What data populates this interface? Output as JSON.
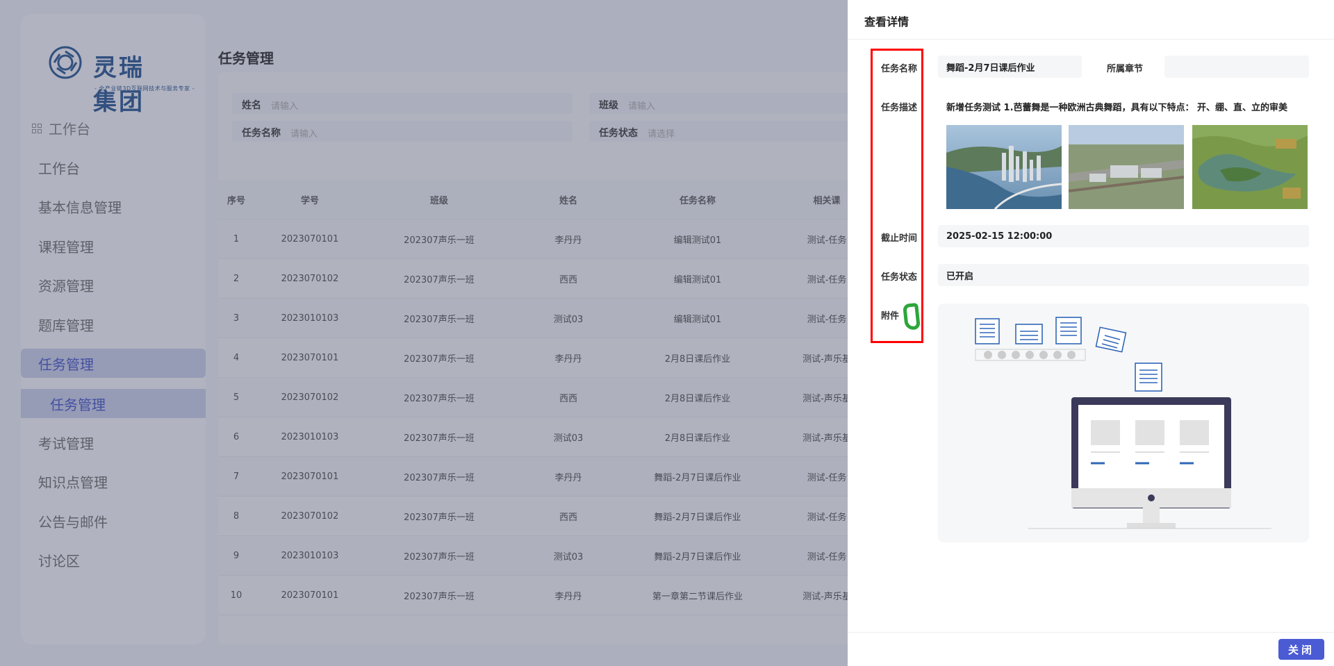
{
  "brand": {
    "name": "灵瑞集团",
    "tagline": "- 全产业链3D互联网技术与服务专家 -",
    "color": "#1d4d8c"
  },
  "sidebar": {
    "group_label": "工作台",
    "items": [
      {
        "label": "工作台"
      },
      {
        "label": "基本信息管理"
      },
      {
        "label": "课程管理"
      },
      {
        "label": "资源管理"
      },
      {
        "label": "题库管理"
      },
      {
        "label": "任务管理",
        "active": true
      },
      {
        "label": "任务管理",
        "sub": true
      },
      {
        "label": "考试管理"
      },
      {
        "label": "知识点管理"
      },
      {
        "label": "公告与邮件"
      },
      {
        "label": "讨论区"
      }
    ]
  },
  "page": {
    "title": "任务管理",
    "filters": {
      "name_label": "姓名",
      "name_placeholder": "请输入",
      "class_label": "班级",
      "class_placeholder": "请输入",
      "task_label": "任务名称",
      "task_placeholder": "请输入",
      "status_label": "任务状态",
      "status_placeholder": "请选择"
    },
    "table": {
      "columns": [
        "序号",
        "学号",
        "班级",
        "姓名",
        "任务名称",
        "相关课"
      ],
      "rows": [
        [
          "1",
          "2023070101",
          "202307声乐一班",
          "李丹丹",
          "编辑测试01",
          "测试-任务"
        ],
        [
          "2",
          "2023070102",
          "202307声乐一班",
          "西西",
          "编辑测试01",
          "测试-任务"
        ],
        [
          "3",
          "2023010103",
          "202307声乐一班",
          "测试03",
          "编辑测试01",
          "测试-任务"
        ],
        [
          "4",
          "2023070101",
          "202307声乐一班",
          "李丹丹",
          "2月8日课后作业",
          "测试-声乐基"
        ],
        [
          "5",
          "2023070102",
          "202307声乐一班",
          "西西",
          "2月8日课后作业",
          "测试-声乐基"
        ],
        [
          "6",
          "2023010103",
          "202307声乐一班",
          "测试03",
          "2月8日课后作业",
          "测试-声乐基"
        ],
        [
          "7",
          "2023070101",
          "202307声乐一班",
          "李丹丹",
          "舞蹈-2月7日课后作业",
          "测试-任务"
        ],
        [
          "8",
          "2023070102",
          "202307声乐一班",
          "西西",
          "舞蹈-2月7日课后作业",
          "测试-任务"
        ],
        [
          "9",
          "2023010103",
          "202307声乐一班",
          "测试03",
          "舞蹈-2月7日课后作业",
          "测试-任务"
        ],
        [
          "10",
          "2023070101",
          "202307声乐一班",
          "李丹丹",
          "第一章第二节课后作业",
          "测试-声乐基"
        ]
      ]
    }
  },
  "drawer": {
    "title": "查看详情",
    "task_name_label": "任务名称",
    "task_name_value": "舞蹈-2月7日课后作业",
    "chapter_label": "所属章节",
    "chapter_value": "",
    "desc_label": "任务描述",
    "desc_value": "新增任务测试 1.芭蕾舞是一种欧洲古典舞蹈，具有以下特点： 开、绷、直、立的审美",
    "deadline_label": "截止时间",
    "deadline_value": "2025-02-15 12:00:00",
    "status_label": "任务状态",
    "status_value": "已开启",
    "attachment_label": "附件",
    "close_label": "关闭"
  },
  "colors": {
    "accent": "#4a5bd4",
    "annotation_red": "#ff0000",
    "annotation_green": "#2ca63a"
  }
}
